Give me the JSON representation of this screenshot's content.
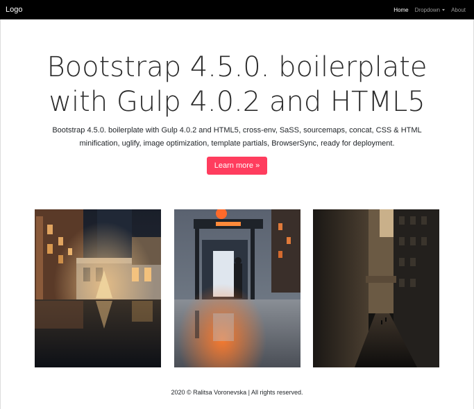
{
  "navbar": {
    "brand": "Logo",
    "links": [
      {
        "label": "Home"
      },
      {
        "label": "Dropdown"
      },
      {
        "label": "About"
      }
    ]
  },
  "hero": {
    "title": "Bootstrap 4.5.0. boilerplate with Gulp 4.0.2 and HTML5",
    "lead": "Bootstrap 4.5.0. boilerplate with Gulp 4.0.2 and HTML5, cross-env, SaSS, sourcemaps, concat, CSS & HTML minification, uglify, image optimization, template partials, BrowserSync, ready for deployment.",
    "button_label": "Learn more »"
  },
  "gallery": [
    {
      "name": "city-night-christmas-tree-photo"
    },
    {
      "name": "bus-stop-rain-night-photo"
    },
    {
      "name": "city-street-buildings-photo"
    }
  ],
  "footer": {
    "text": "2020 © Ralitsa Voronevska | All rights reserved."
  },
  "colors": {
    "navbar_bg": "#000000",
    "button_bg": "#ff3d5e",
    "nav_active": "#ffffff",
    "nav_inactive": "#9a9a9a"
  }
}
